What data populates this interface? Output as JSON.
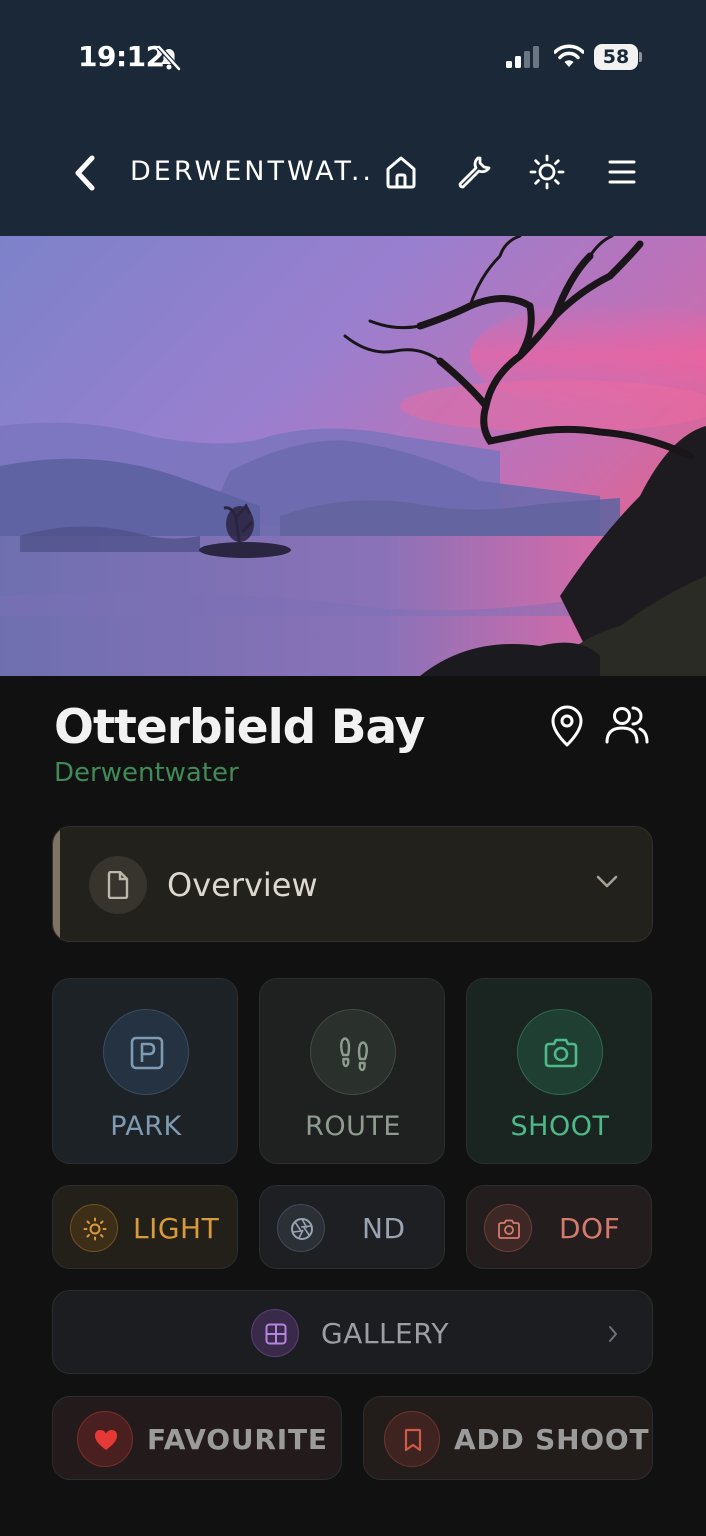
{
  "status_bar": {
    "time": "19:12",
    "battery": "58",
    "icons": [
      "bell-muted-icon",
      "cellular-signal-icon",
      "wifi-icon",
      "battery-icon"
    ]
  },
  "nav": {
    "title": "DERWENTWAT...",
    "icons": [
      "back-icon",
      "home-icon",
      "wrench-icon",
      "brightness-icon",
      "menu-icon"
    ],
    "background": "#1b2838"
  },
  "hero": {
    "icons": [
      "lake-sunset-photo"
    ]
  },
  "location": {
    "title": "Otterbield Bay",
    "subtitle": "Derwentwater",
    "subtitle_color": "#3f8a56",
    "icons": [
      "map-pin-icon",
      "people-icon"
    ]
  },
  "overview": {
    "label": "Overview",
    "icons": [
      "document-icon",
      "chevron-down-icon"
    ]
  },
  "tiles": {
    "park": {
      "label": "PARK",
      "color": "#7f9bb4",
      "icon": "parking-icon"
    },
    "route": {
      "label": "ROUTE",
      "color": "#8e9b8f",
      "icon": "footprints-icon"
    },
    "shoot": {
      "label": "SHOOT",
      "color": "#4fb98a",
      "icon": "camera-icon"
    },
    "light": {
      "label": "LIGHT",
      "color": "#d99a3a",
      "icon": "sun-icon"
    },
    "nd": {
      "label": "ND",
      "color": "#9aa3b1",
      "icon": "aperture-icon"
    },
    "dof": {
      "label": "DOF",
      "color": "#d47a6c",
      "icon": "camera-icon"
    }
  },
  "gallery": {
    "label": "GALLERY",
    "icons": [
      "grid-icon",
      "chevron-right-icon"
    ]
  },
  "actions": {
    "favourite": {
      "label": "FAVOURITE",
      "color": "#e53935",
      "icon": "heart-icon"
    },
    "add_shoot": {
      "label": "ADD SHOOT",
      "color": "#cf5a45",
      "icon": "bookmark-icon"
    }
  }
}
